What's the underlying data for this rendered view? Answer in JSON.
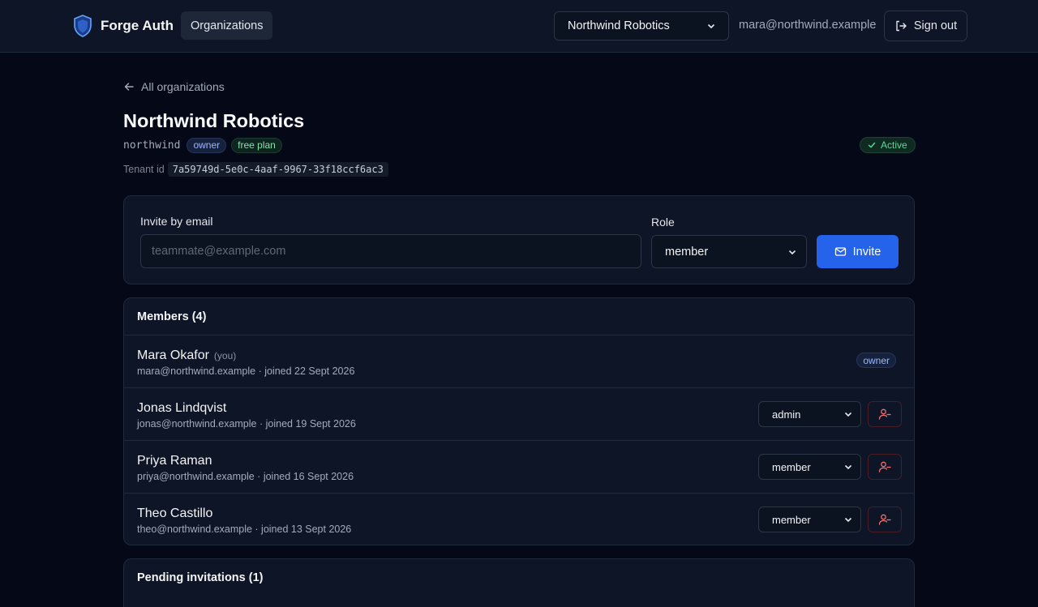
{
  "app": {
    "name": "Forge Auth"
  },
  "nav": {
    "organizations_label": "Organizations"
  },
  "org_switcher": {
    "selected": "Northwind Robotics"
  },
  "user": {
    "email": "mara@northwind.example"
  },
  "signout_label": "Sign out",
  "back_link": "All organizations",
  "org": {
    "name": "Northwind Robotics",
    "slug": "northwind",
    "role_badge": "owner",
    "plan_badge": "free plan",
    "status": "Active",
    "tenant_label": "Tenant id",
    "tenant_id": "7a59749d-5e0c-4aaf-9967-33f18ccf6ac3"
  },
  "invite": {
    "email_label": "Invite by email",
    "email_placeholder": "teammate@example.com",
    "email_value": "",
    "role_label": "Role",
    "role_selected": "member",
    "button_label": "Invite"
  },
  "members": {
    "title": "Members (4)",
    "you_tag": "(you)",
    "rows": [
      {
        "name": "Mara Okafor",
        "email": "mara@northwind.example",
        "joined": "joined 22 Sept 2026",
        "role": "owner"
      },
      {
        "name": "Jonas Lindqvist",
        "email": "jonas@northwind.example",
        "joined": "joined 19 Sept 2026",
        "role": "admin"
      },
      {
        "name": "Priya Raman",
        "email": "priya@northwind.example",
        "joined": "joined 16 Sept 2026",
        "role": "member"
      },
      {
        "name": "Theo Castillo",
        "email": "theo@northwind.example",
        "joined": "joined 13 Sept 2026",
        "role": "member"
      }
    ],
    "separator": " · "
  },
  "pending": {
    "title": "Pending invitations (1)"
  },
  "colors": {
    "background": "#050816",
    "surface": "#0d1526",
    "accent": "#2563eb",
    "danger": "#f87171",
    "success": "#5ed89a"
  },
  "icons": {
    "brand": "shield-icon",
    "signout": "log-out-icon",
    "back": "arrow-left-icon",
    "status": "check-icon",
    "invite": "mail-icon",
    "remove": "user-minus-icon",
    "select": "chevron-down-icon"
  }
}
